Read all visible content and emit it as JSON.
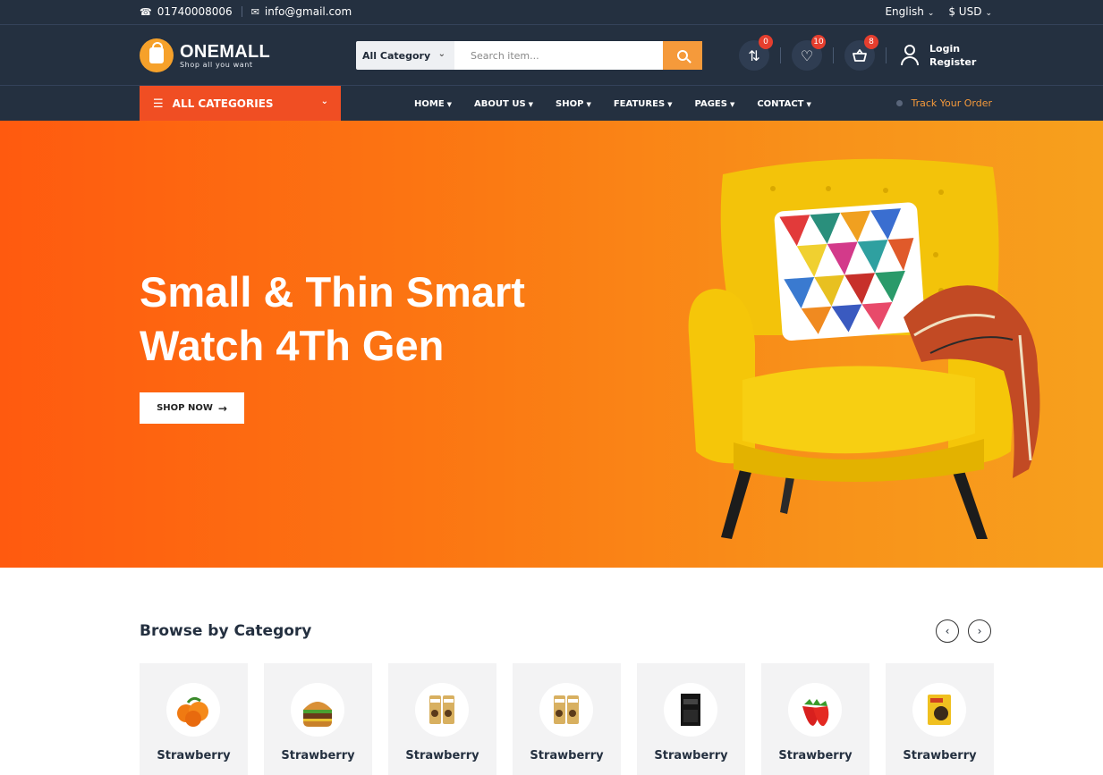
{
  "topbar": {
    "phone": "01740008006",
    "email": "info@gmail.com",
    "language": "English",
    "currency": "$ USD"
  },
  "brand": {
    "name": "ONEMALL",
    "tagline": "Shop all you want",
    "accent": "#f6a12a"
  },
  "search": {
    "category": "All Category",
    "placeholder": "Search item...",
    "button_color": "#f59a3b"
  },
  "header_icons": [
    {
      "icon": "compare-icon",
      "badge": "0"
    },
    {
      "icon": "heart-icon",
      "badge": "10"
    },
    {
      "icon": "cart-icon",
      "badge": "8"
    }
  ],
  "account": {
    "login": "Login",
    "register": "Register"
  },
  "nav": {
    "all_categories": "ALL CATEGORIES",
    "items": [
      "HOME",
      "ABOUT US",
      "SHOP",
      "FEATURES",
      "PAGES",
      "CONTACT"
    ],
    "track_order": "Track Your Order"
  },
  "hero": {
    "title": "Small & Thin Smart Watch 4Th Gen",
    "button": "SHOP NOW",
    "gradient_start": "#ff5a0f",
    "gradient_end": "#f7a01d"
  },
  "categories_section": {
    "title": "Browse by Category",
    "items": [
      {
        "name": "Strawberry",
        "icon": "oranges-icon"
      },
      {
        "name": "Strawberry",
        "icon": "burger-icon"
      },
      {
        "name": "Strawberry",
        "icon": "snack-bag-icon"
      },
      {
        "name": "Strawberry",
        "icon": "snack-bag-icon"
      },
      {
        "name": "Strawberry",
        "icon": "dark-chocolate-icon"
      },
      {
        "name": "Strawberry",
        "icon": "strawberry-icon"
      },
      {
        "name": "Strawberry",
        "icon": "seed-pack-icon"
      }
    ]
  }
}
